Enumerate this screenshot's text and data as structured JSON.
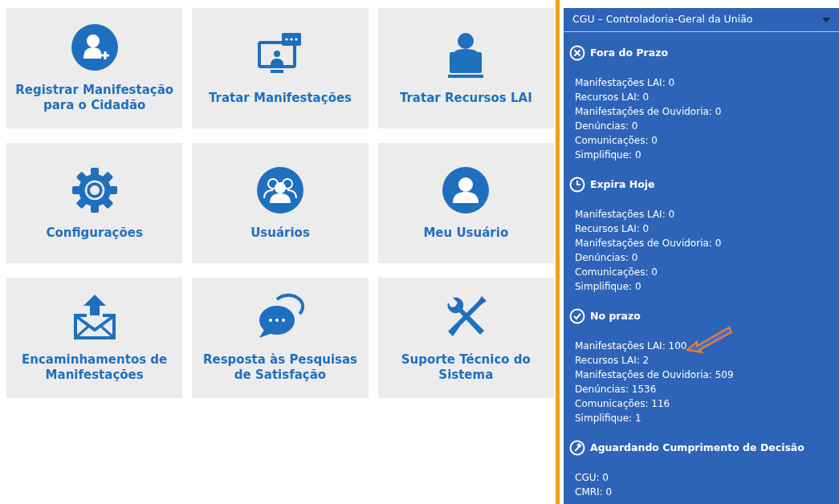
{
  "tiles": [
    {
      "label": "Registrar Manifestação para o Cidadão",
      "kind": "useradd"
    },
    {
      "label": "Tratar Manifestações",
      "kind": "monitor"
    },
    {
      "label": "Tratar Recursos LAI",
      "kind": "laptop"
    },
    {
      "label": "Configurações",
      "kind": "gear"
    },
    {
      "label": "Usuários",
      "kind": "users"
    },
    {
      "label": "Meu Usuário",
      "kind": "user"
    },
    {
      "label": "Encaminhamentos de Manifestações",
      "kind": "envelope"
    },
    {
      "label": "Resposta às Pesquisas de Satisfação",
      "kind": "chat"
    },
    {
      "label": "Suporte Técnico do Sistema",
      "kind": "tools"
    }
  ],
  "panel": {
    "selector": {
      "value": "CGU – Controladoria-Geral da União"
    },
    "sections": [
      {
        "title": "Fora do Prazo",
        "kind": "late",
        "items": [
          "Manifestações LAI: 0",
          "Recursos LAI: 0",
          "Manifestações de Ouvidoria: 0",
          "Denúncias: 0",
          "Comunicações: 0",
          "Simplifique: 0"
        ]
      },
      {
        "title": "Expira Hoje",
        "kind": "today",
        "items": [
          "Manifestações LAI: 0",
          "Recursos LAI: 0",
          "Manifestações de Ouvidoria: 0",
          "Denúncias: 0",
          "Comunicações: 0",
          "Simplifique: 0"
        ]
      },
      {
        "title": "No prazo",
        "kind": "ontime",
        "items": [
          "Manifestações LAI: 100",
          "Recursos LAI: 2",
          "Manifestações de Ouvidoria: 509",
          "Denúncias: 1536",
          "Comunicações: 116",
          "Simplifique: 1"
        ]
      },
      {
        "title": "Aguardando Cumprimento de Decisão",
        "kind": "awaiting",
        "items": [
          "CGU: 0",
          "CMRI: 0"
        ]
      }
    ]
  }
}
